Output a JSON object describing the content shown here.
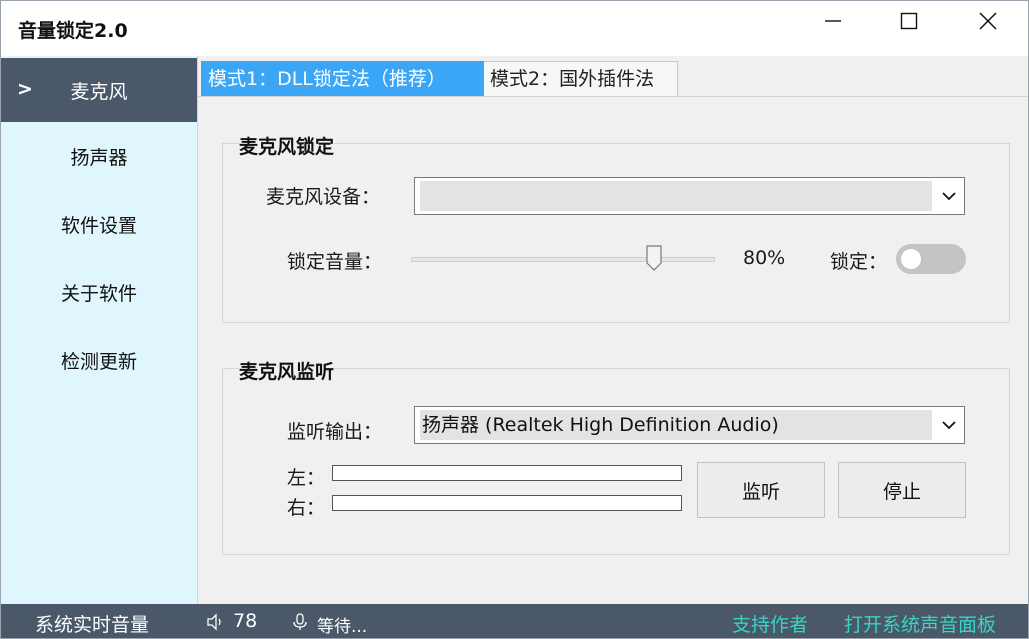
{
  "window": {
    "title": "音量锁定2.0",
    "controls": [
      "minimize-icon",
      "maximize-icon",
      "close-icon"
    ]
  },
  "sidebar": {
    "active_marker": ">",
    "items": [
      {
        "label": "麦克风",
        "active": true
      },
      {
        "label": "扬声器",
        "active": false
      },
      {
        "label": "软件设置",
        "active": false
      },
      {
        "label": "关于软件",
        "active": false
      },
      {
        "label": "检测更新",
        "active": false
      }
    ]
  },
  "tabs": [
    {
      "label": "模式1：DLL锁定法（推荐）",
      "active": true
    },
    {
      "label": "模式2：国外插件法",
      "active": false
    }
  ],
  "mic_lock": {
    "title": "麦克风锁定",
    "device_label": "麦克风设备：",
    "device_value": "",
    "volume_label": "锁定音量：",
    "volume_value": 80,
    "volume_text": "80%",
    "lock_label": "锁定：",
    "lock_on": false
  },
  "mic_monitor": {
    "title": "麦克风监听",
    "output_label": "监听输出：",
    "output_value": "扬声器 (Realtek High Definition Audio)",
    "left_label": "左：",
    "right_label": "右：",
    "left_level": 0,
    "right_level": 0,
    "listen_button": "监听",
    "stop_button": "停止"
  },
  "statusbar": {
    "system_volume_label": "系统实时音量",
    "speaker_icon": "speaker-icon",
    "speaker_value": "78",
    "mic_icon": "microphone-icon",
    "mic_status": "等待...",
    "support_link": "支持作者",
    "open_panel_link": "打开系统声音面板"
  },
  "colors": {
    "accent": "#3aa6f5",
    "sidebar_bg": "#dff6fd",
    "dark_bar": "#4a5869",
    "link": "#39d4c4"
  }
}
